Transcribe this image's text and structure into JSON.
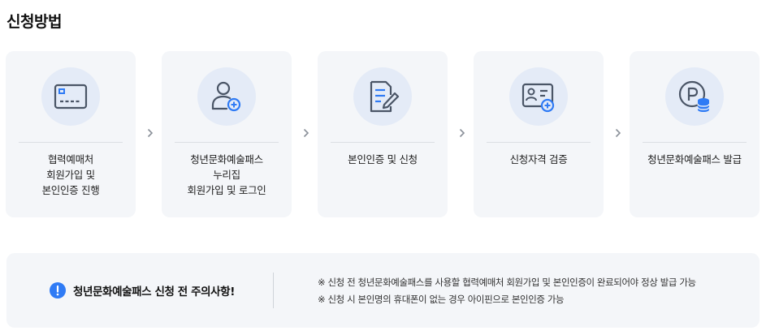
{
  "page_title": "신청방법",
  "colors": {
    "accent": "#2f7bf5",
    "card_bg": "#f4f6f9",
    "icon_bg": "#e4ebf7",
    "icon_stroke": "#4a5566"
  },
  "steps": [
    {
      "icon": "card-icon",
      "lines": [
        "협력예매처",
        "회원가입 및",
        "본인인증 진행"
      ]
    },
    {
      "icon": "user-add-icon",
      "lines": [
        "청년문화예술패스",
        "누리집",
        "회원가입 및 로그인"
      ]
    },
    {
      "icon": "document-edit-icon",
      "lines": [
        "본인인증 및 신청"
      ]
    },
    {
      "icon": "id-card-add-icon",
      "lines": [
        "신청자격 검증"
      ]
    },
    {
      "icon": "point-coin-icon",
      "lines": [
        "청년문화예술패스 발급"
      ]
    }
  ],
  "notice": {
    "icon": "exclamation-icon",
    "title": "청년문화예술패스 신청 전 주의사항!",
    "items": [
      "※ 신청 전 청년문화예술패스를 사용할 협력예매처 회원가입 및 본인인증이 완료되어야 정상 발급 가능",
      "※ 신청 시 본인명의 휴대폰이 없는 경우 아이핀으로 본인인증 가능"
    ]
  }
}
